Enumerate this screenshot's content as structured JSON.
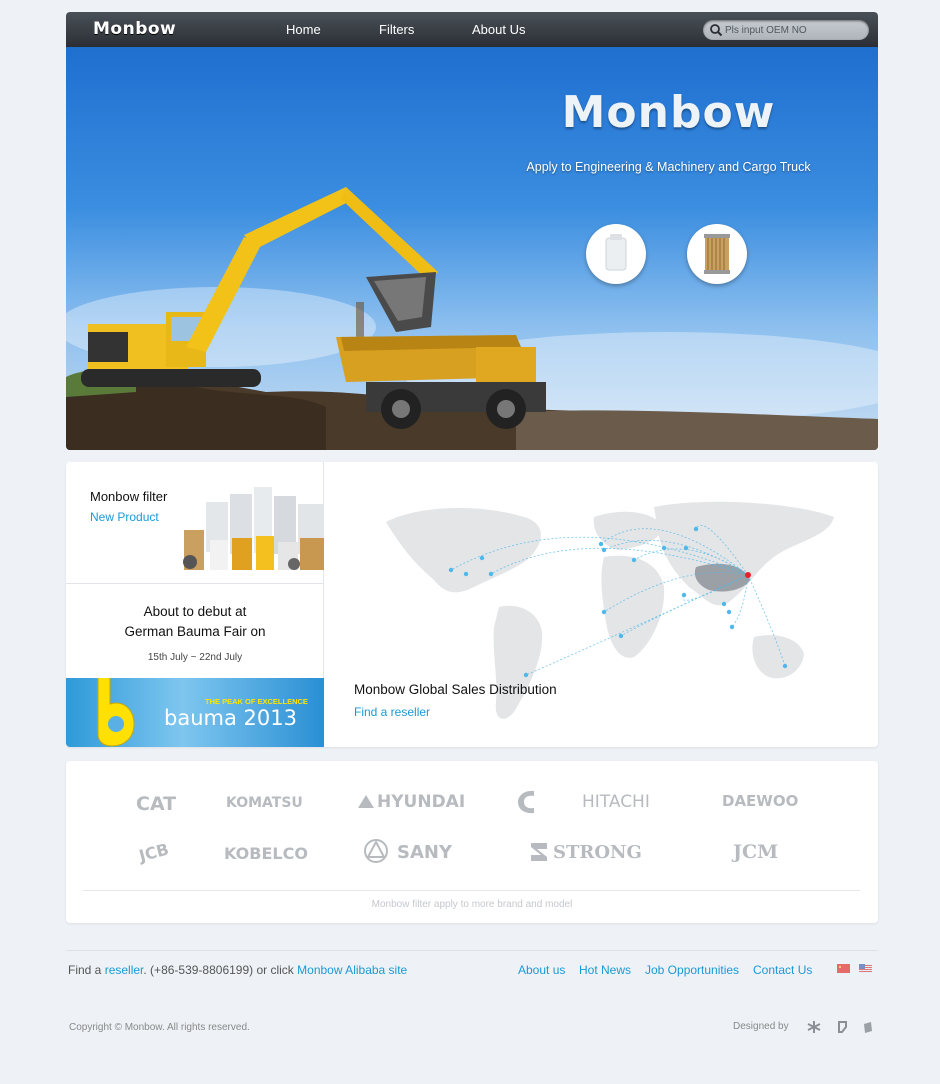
{
  "nav": {
    "logo": "Monbow",
    "links": [
      "Home",
      "Filters",
      "About Us"
    ],
    "search_placeholder": "Pls input OEM NO"
  },
  "hero": {
    "brand": "Monbow",
    "tagline": "Apply to Engineering & Machinery and Cargo Truck"
  },
  "feature": {
    "filter_title": "Monbow filter",
    "new_product_link": "New Product",
    "debut_line1": "About to debut at",
    "debut_line2": "German Bauma Fair on",
    "debut_date": "15th July ~ 22nd July",
    "bauma_tagline": "THE PEAK OF EXCELLENCE",
    "bauma_word": "bauma 2013",
    "map_title": "Monbow Global Sales Distribution",
    "map_link": "Find a reseller"
  },
  "brands": {
    "row1": [
      "CAT",
      "KOMATSU",
      "HYUNDAI",
      "HITACHI",
      "DAEWOO"
    ],
    "row2": [
      "JCB",
      "KOBELCO",
      "SANY",
      "STRONG",
      "JCM"
    ],
    "note": "Monbow filter apply to more brand and model"
  },
  "footer": {
    "find_prefix": "Find a",
    "reseller_link": "reseller",
    "phone": ". (+86-539-8806199) or click",
    "alibaba_link": "Monbow Alibaba site",
    "links": [
      "About us",
      "Hot News",
      "Job Opportunities",
      "Contact Us"
    ],
    "copyright": "Copyright © Monbow. All rights reserved.",
    "designed_by": "Designed by"
  },
  "colors": {
    "link": "#1a9ad6",
    "nav_bg": "#2b2f35",
    "page_bg": "#eef2f6"
  }
}
